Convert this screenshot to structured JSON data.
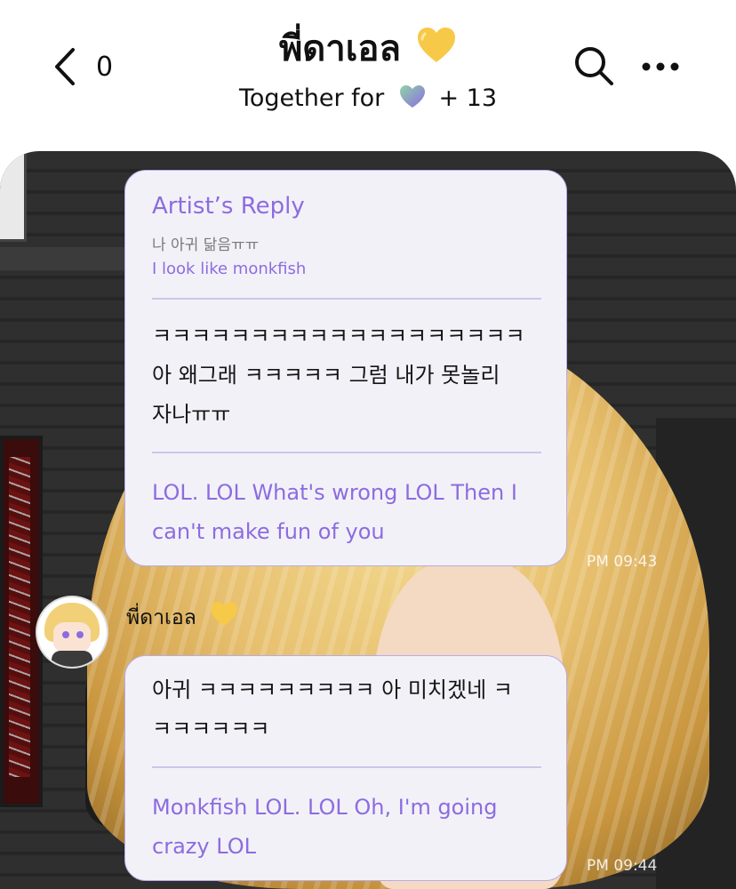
{
  "header": {
    "unread_count": "0",
    "title": "พี่ดาเอล",
    "title_emoji": "yellow-heart-icon",
    "subtitle_prefix": "Together for",
    "subtitle_emoji": "gradient-heart-icon",
    "subtitle_suffix": "+ 13",
    "icons": [
      "back-chevron-icon",
      "search-icon",
      "more-dots-icon"
    ]
  },
  "colors": {
    "accent": "#8c6ce0",
    "bubble_bg": "#f3f1f8",
    "bubble_border": "#b7abe8",
    "heart_yellow": "#f7c948"
  },
  "messages": [
    {
      "type": "artist_reply_with_message",
      "reply_label": "Artist’s Reply",
      "reply_original": "나 아귀 닮음ㅠㅠ",
      "reply_translation": "I look like monkfish",
      "text": "ㅋㅋㅋㅋㅋㅋㅋㅋㅋㅋㅋㅋㅋㅋㅋㅋㅋㅋㅋ\n아 왜그래 ㅋㅋㅋㅋㅋ 그럼 내가 못놀리\n자나ㅠㅠ",
      "translation": "LOL. LOL What's wrong LOL Then I can't make fun of you",
      "time": "PM 09:43"
    },
    {
      "type": "message",
      "sender": "พี่ดาเอล",
      "sender_emoji": "yellow-heart-icon",
      "text": "아귀 ㅋㅋㅋㅋㅋㅋㅋㅋㅋ 아 미치겠네 ㅋ\nㅋㅋㅋㅋㅋㅋ",
      "translation": "Monkfish LOL. LOL Oh, I'm going crazy LOL",
      "time": "PM 09:44"
    }
  ]
}
